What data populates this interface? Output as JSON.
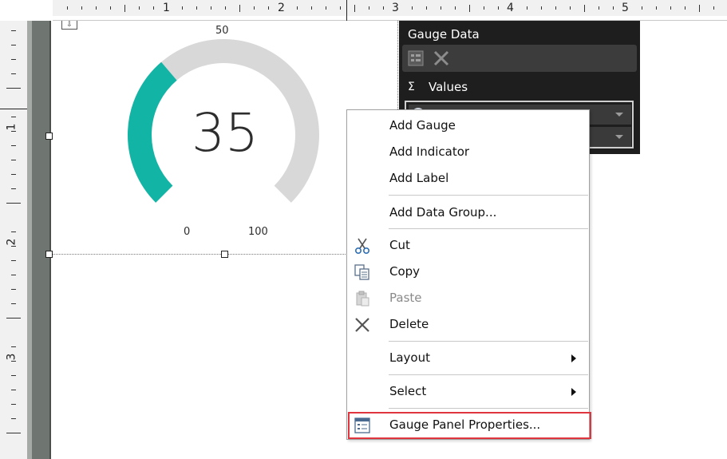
{
  "ruler": {
    "horizontal_labels": [
      "1",
      "2",
      "3",
      "4",
      "5"
    ],
    "vertical_labels": [
      "1",
      "2",
      "3"
    ]
  },
  "gauge": {
    "value": "35",
    "value_numeric": 35,
    "min_label": "0",
    "max_label": "100",
    "mid_label": "50",
    "min": 0,
    "max": 100,
    "fill_color": "#12b5a5",
    "track_color": "#d8d8d8"
  },
  "gauge_data_panel": {
    "title": "Gauge Data",
    "toolbar_icons": [
      "properties-icon",
      "delete-icon"
    ],
    "values_label": "Values",
    "sigma_icon": "sigma-icon"
  },
  "context_menu": {
    "items": [
      {
        "label": "Add Gauge"
      },
      {
        "label": "Add Indicator"
      },
      {
        "label": "Add Label"
      },
      {
        "label": "Add Data Group..."
      },
      {
        "label": "Cut",
        "icon": "scissors-icon"
      },
      {
        "label": "Copy",
        "icon": "copy-icon"
      },
      {
        "label": "Paste",
        "icon": "paste-icon",
        "disabled": true
      },
      {
        "label": "Delete",
        "icon": "delete-x-icon"
      },
      {
        "label": "Layout",
        "submenu": true
      },
      {
        "label": "Select",
        "submenu": true
      },
      {
        "label": "Gauge Panel Properties...",
        "icon": "properties-icon",
        "highlighted": true
      }
    ]
  },
  "colors": {
    "highlight_border": "#e0353f",
    "panel_background": "#1e1e1e"
  }
}
